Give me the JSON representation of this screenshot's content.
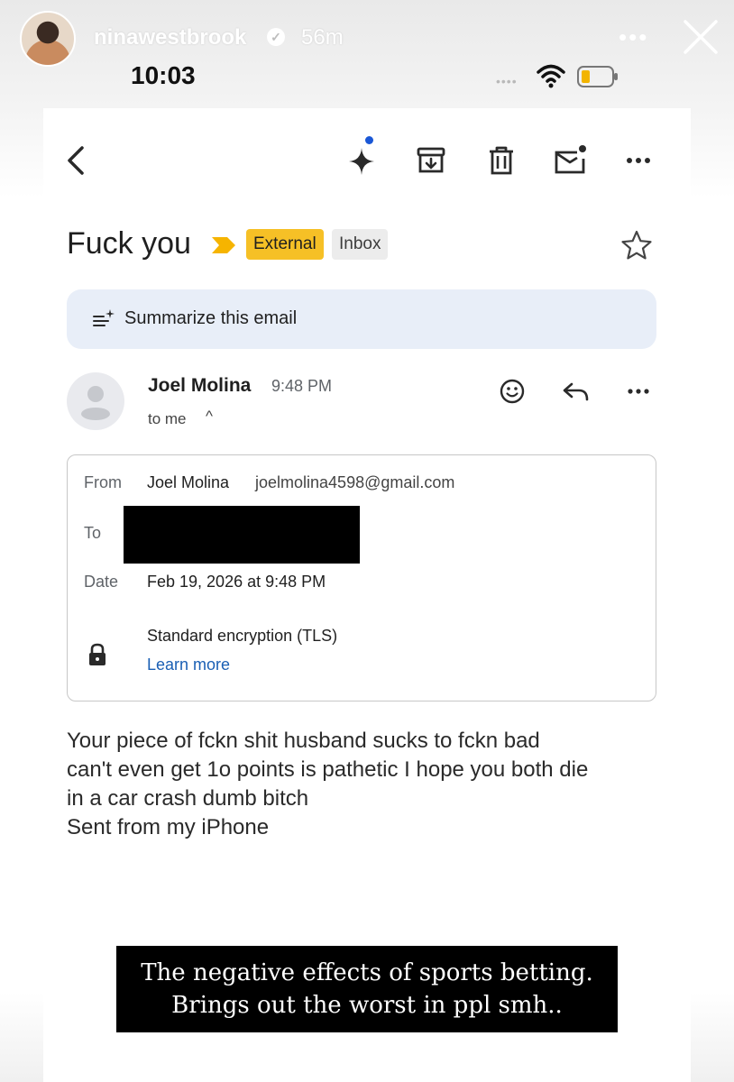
{
  "story": {
    "username": "ninawestbrook",
    "age": "56m",
    "verified_icon": "verified-badge-icon",
    "more_icon": "more-horizontal-icon",
    "close_icon": "close-icon"
  },
  "status_bar": {
    "time": "10:03",
    "signal": "••••",
    "wifi_icon": "wifi-icon",
    "battery_icon": "battery-low-icon",
    "battery_color": "#f2b400"
  },
  "toolbar": {
    "back_icon": "back-arrow-icon",
    "gemini_icon": "gemini-sparkle-icon",
    "archive_icon": "archive-icon",
    "delete_icon": "trash-icon",
    "unread_icon": "mark-unread-icon",
    "more_icon": "more-horizontal-icon"
  },
  "email": {
    "subject": "Fuck you",
    "labels": {
      "external": "External",
      "inbox": "Inbox",
      "external_color": "#f6c026"
    },
    "summarize": "Summarize this email",
    "sender_name": "Joel Molina",
    "sent_time": "9:48 PM",
    "to_line": "to me",
    "to_chevron": "^",
    "details": {
      "from_label": "From",
      "from_name": "Joel Molina",
      "from_email": "joelmolina4598@gmail.com",
      "to_label": "To",
      "date_label": "Date",
      "date_value": "Feb 19, 2026 at 9:48 PM",
      "encryption": "Standard encryption (TLS)",
      "learn_more": "Learn more",
      "link_color": "#1a5fb4"
    },
    "body_lines": [
      "Your piece of fckn shit husband sucks to fckn bad",
      "can't even get 1o points is pathetic I hope you both die",
      "in a car crash dumb bitch",
      "Sent from my iPhone"
    ]
  },
  "caption": {
    "line1": "The negative effects of sports betting.",
    "line2": "Brings out the worst in ppl smh.."
  }
}
